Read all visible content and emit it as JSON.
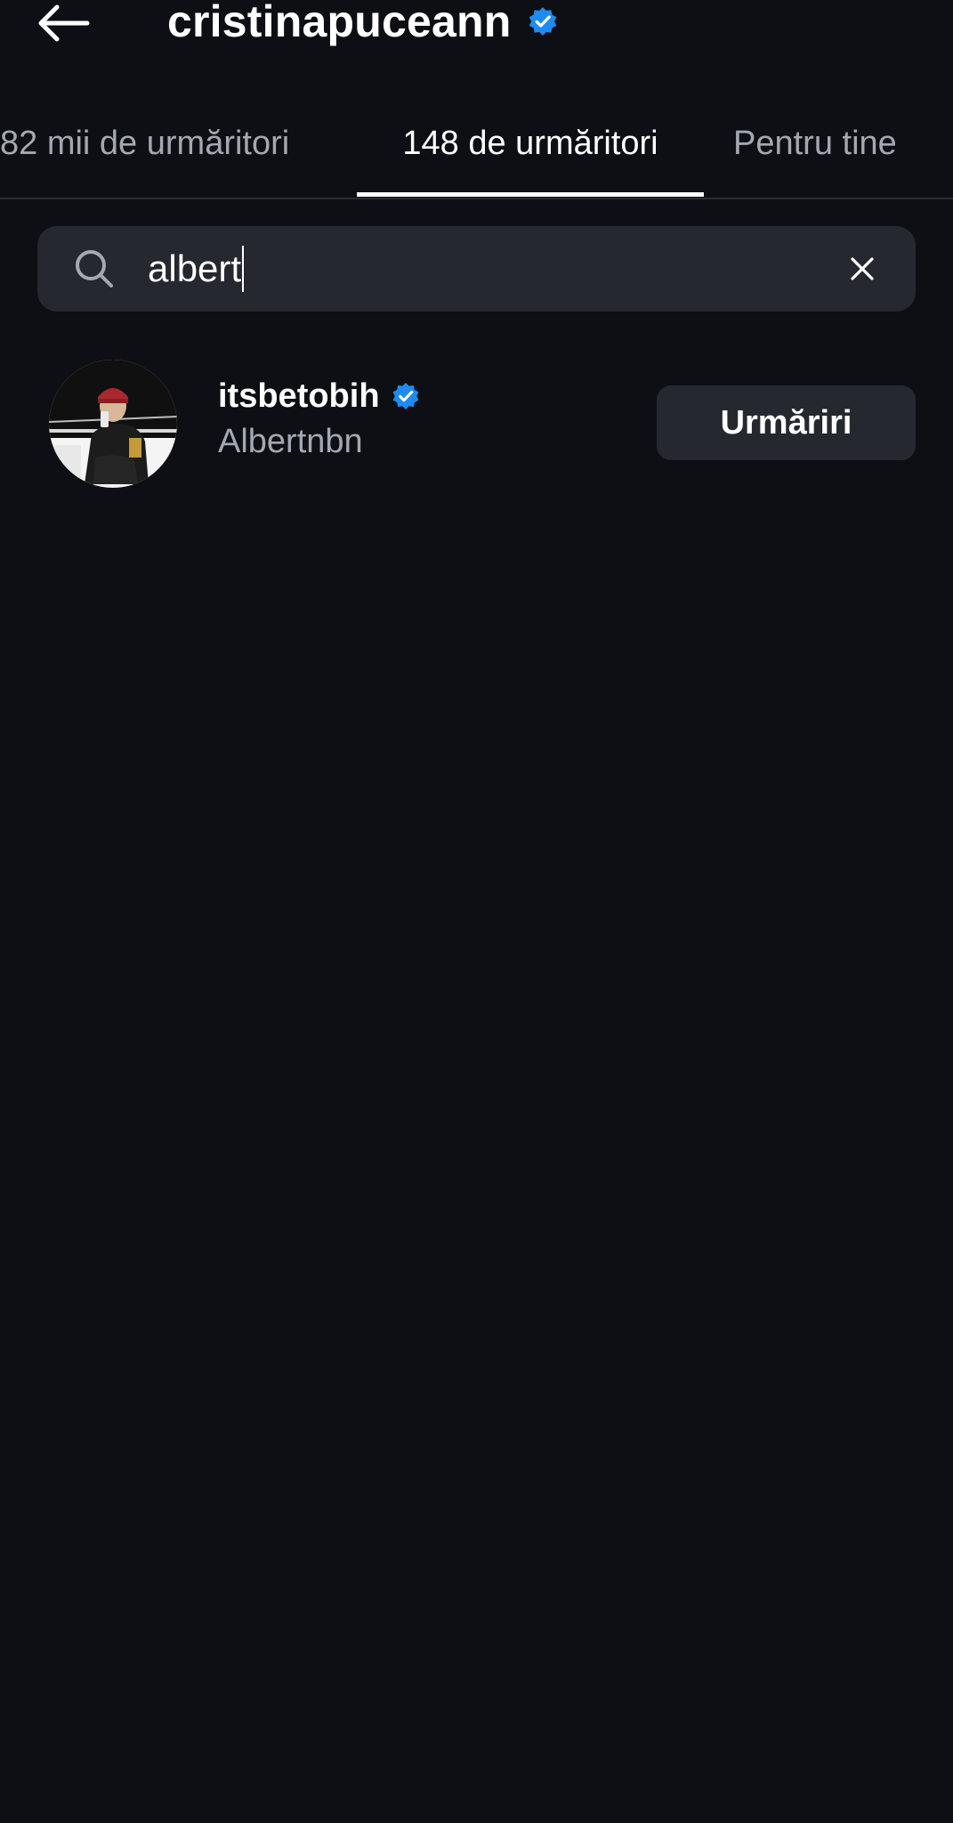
{
  "header": {
    "title": "cristinapuceann",
    "back_icon": "arrow-left-icon",
    "verified_icon": "verified-badge-icon"
  },
  "tabs": [
    {
      "label": "82 mii de urmăritori",
      "active": false
    },
    {
      "label": "148 de urmăritori",
      "active": true
    },
    {
      "label": "Pentru tine",
      "active": false
    }
  ],
  "search": {
    "value": "albert",
    "search_icon": "search-icon",
    "clear_icon": "close-icon"
  },
  "results": [
    {
      "username": "itsbetobih",
      "full_name": "Albertnbn",
      "verified": true,
      "button_label": "Urmăriri"
    }
  ],
  "colors": {
    "background": "#0e0f14",
    "surface": "#26282f",
    "text_primary": "#ffffff",
    "text_secondary": "#a4a8b2",
    "verified_blue": "#1d8bf1"
  }
}
